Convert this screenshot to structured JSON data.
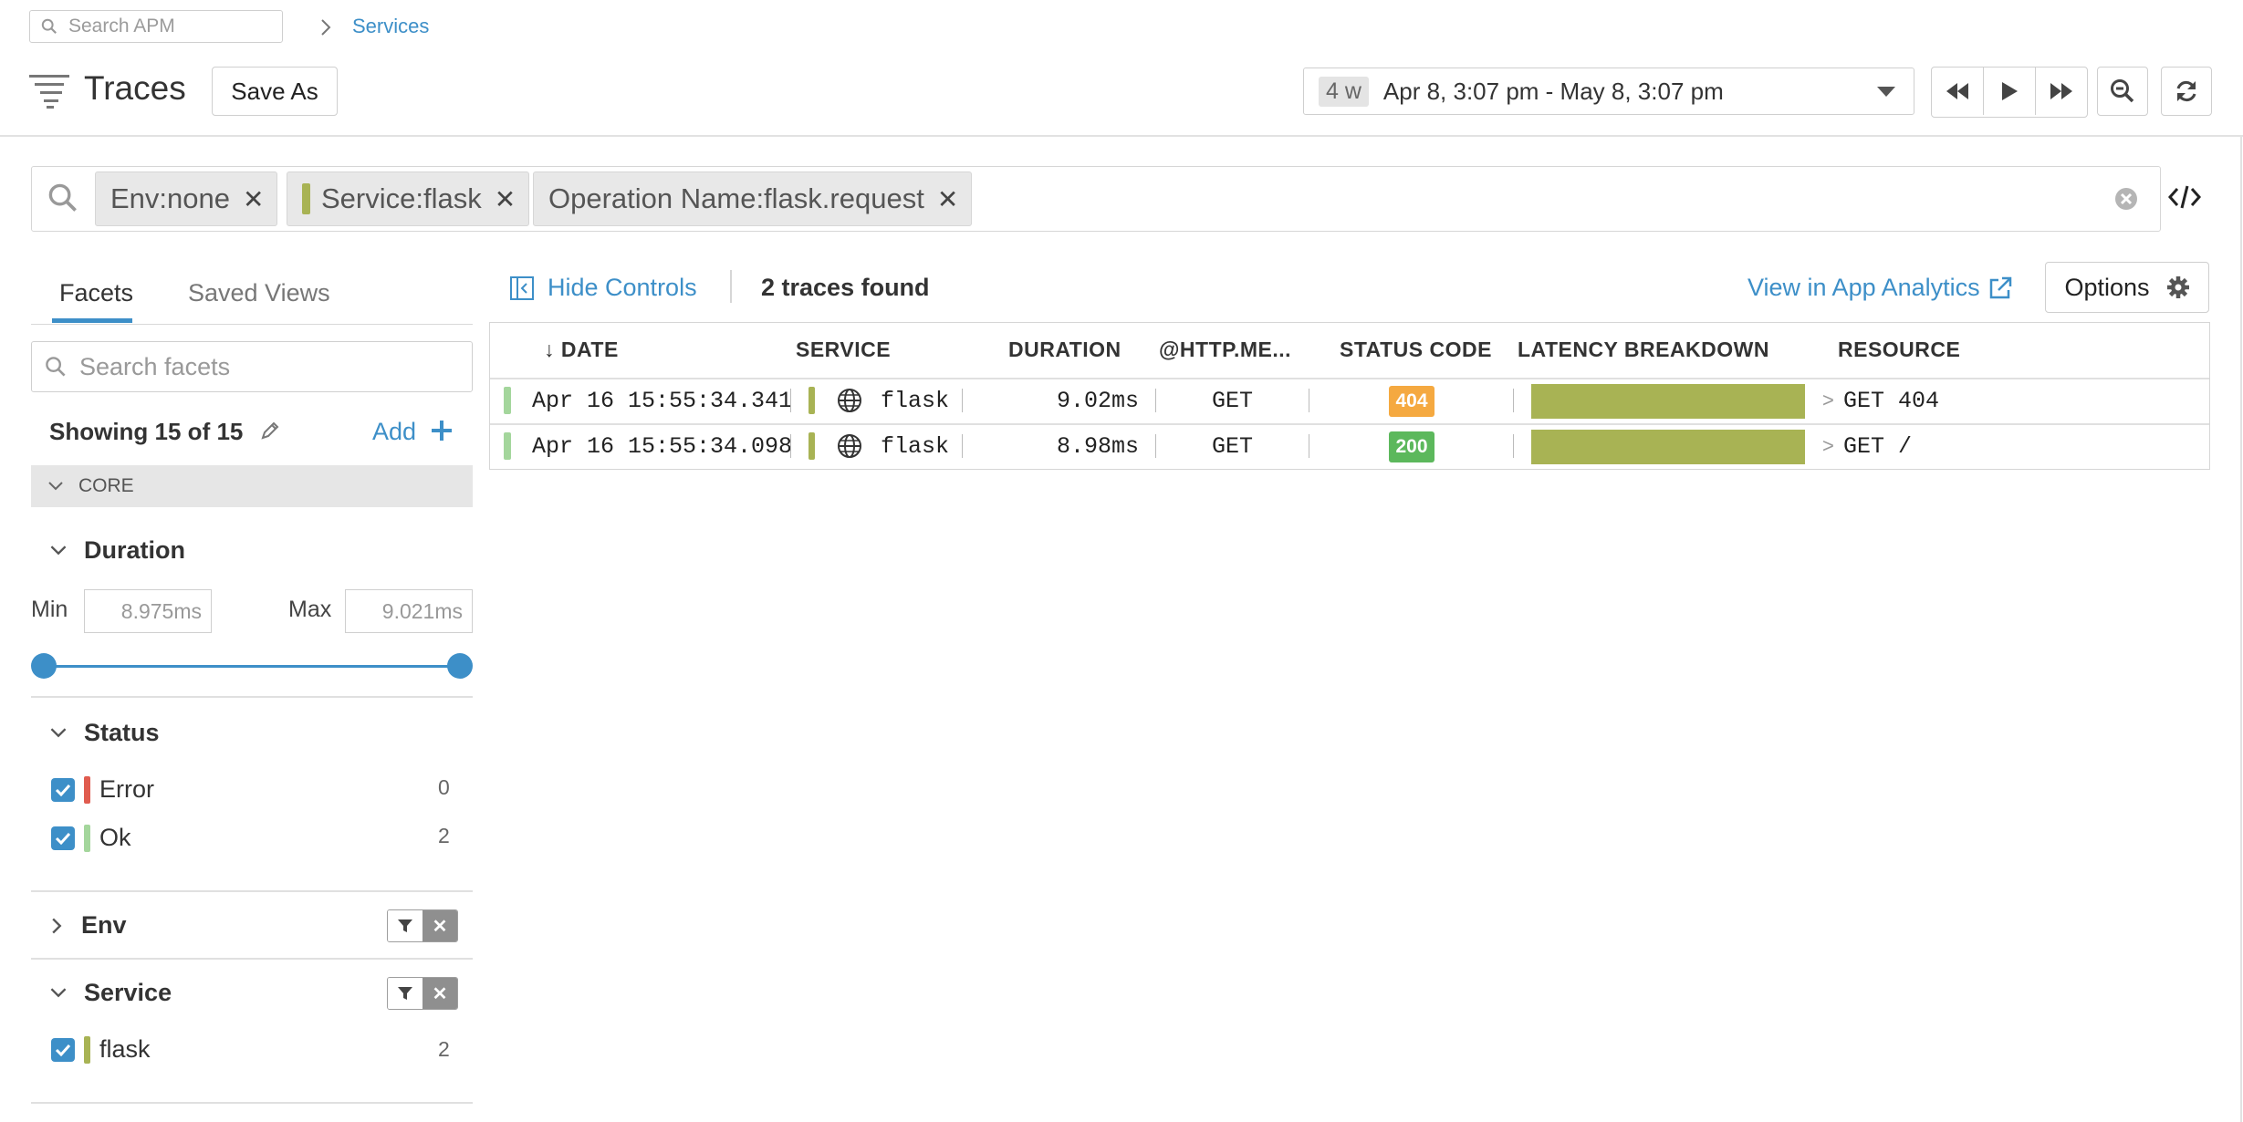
{
  "header": {
    "search_placeholder": "Search APM",
    "breadcrumb": "Services",
    "title": "Traces",
    "save_as": "Save As",
    "time_badge": "4 w",
    "time_range": "Apr 8, 3:07 pm - May 8, 3:07 pm"
  },
  "filters": [
    {
      "label": "Env:none",
      "colored": false
    },
    {
      "label": "Service:flask",
      "colored": true
    },
    {
      "label": "Operation Name:flask.request",
      "colored": false
    }
  ],
  "sidebar": {
    "tabs": [
      "Facets",
      "Saved Views"
    ],
    "search_placeholder": "Search facets",
    "showing": "Showing 15 of 15",
    "add": "Add",
    "core": "CORE",
    "duration": {
      "title": "Duration",
      "min_label": "Min",
      "max_label": "Max",
      "min_value": "8.975ms",
      "max_value": "9.021ms"
    },
    "status": {
      "title": "Status",
      "items": [
        {
          "label": "Error",
          "count": "0",
          "color": "#e05c4f"
        },
        {
          "label": "Ok",
          "count": "2",
          "color": "#a4d69c"
        }
      ]
    },
    "env": {
      "title": "Env"
    },
    "service": {
      "title": "Service",
      "items": [
        {
          "label": "flask",
          "count": "2",
          "color": "#a8b354"
        }
      ]
    }
  },
  "results": {
    "hide_controls": "Hide Controls",
    "found": "2 traces found",
    "view_analytics": "View in App Analytics",
    "options": "Options",
    "columns": [
      "DATE",
      "SERVICE",
      "DURATION",
      "@HTTP.ME...",
      "STATUS CODE",
      "LATENCY BREAKDOWN",
      "RESOURCE"
    ],
    "sort_arrow": "↓",
    "rows": [
      {
        "date": "Apr 16 15:55:34.341",
        "service": "flask",
        "duration": "9.02ms",
        "method": "GET",
        "status": "404",
        "status_color": "#f5a940",
        "resource": "GET 404"
      },
      {
        "date": "Apr 16 15:55:34.098",
        "service": "flask",
        "duration": "8.98ms",
        "method": "GET",
        "status": "200",
        "status_color": "#5cb85c",
        "resource": "GET /"
      }
    ]
  }
}
